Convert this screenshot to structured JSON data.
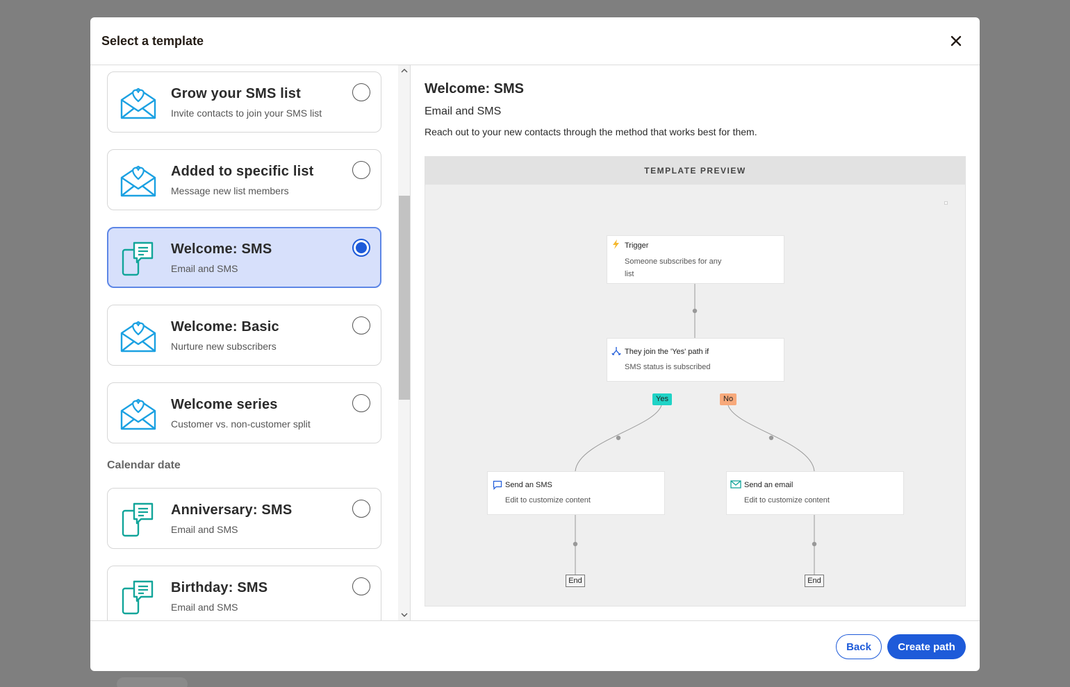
{
  "modal": {
    "title": "Select a template"
  },
  "templates_a": [
    {
      "title": "Grow your SMS list",
      "subtitle": "Invite contacts to join your SMS list",
      "icon": "envelope-heart-icon",
      "selected": false
    },
    {
      "title": "Added to specific list",
      "subtitle": "Message new list members",
      "icon": "envelope-heart-icon",
      "selected": false
    },
    {
      "title": "Welcome: SMS",
      "subtitle": "Email and SMS",
      "icon": "phone-message-icon",
      "selected": true
    },
    {
      "title": "Welcome: Basic",
      "subtitle": "Nurture new subscribers",
      "icon": "envelope-heart-icon",
      "selected": false
    },
    {
      "title": "Welcome series",
      "subtitle": "Customer vs. non-customer split",
      "icon": "envelope-heart-icon",
      "selected": false
    }
  ],
  "section_calendar": "Calendar date",
  "templates_b": [
    {
      "title": "Anniversary: SMS",
      "subtitle": "Email and SMS",
      "icon": "phone-message-icon",
      "selected": false
    },
    {
      "title": "Birthday: SMS",
      "subtitle": "Email and SMS",
      "icon": "phone-message-icon",
      "selected": false
    }
  ],
  "detail": {
    "title": "Welcome: SMS",
    "subtitle": "Email and SMS",
    "description": "Reach out to your new contacts through the method that works best for them."
  },
  "preview": {
    "header": "TEMPLATE PREVIEW",
    "trigger": {
      "title": "Trigger",
      "sub": "Someone subscribes for any list"
    },
    "condition": {
      "title": "They join the 'Yes' path if",
      "sub": "SMS status is subscribed"
    },
    "yes_tag": "Yes",
    "no_tag": "No",
    "sms_node": {
      "title": "Send an SMS",
      "sub": "Edit to customize content"
    },
    "email_node": {
      "title": "Send an email",
      "sub": "Edit to customize content"
    },
    "end_left": "End",
    "end_right": "End"
  },
  "footer": {
    "back": "Back",
    "create": "Create path"
  },
  "colors": {
    "accent": "#1e5bd9",
    "selected_bg": "#d7e0fb",
    "icon_blue": "#1ba1e2",
    "icon_teal": "#12a59a",
    "yes_tag": "#1fd3c6",
    "no_tag": "#f7a97b",
    "trigger_bolt": "#f5b82e"
  }
}
